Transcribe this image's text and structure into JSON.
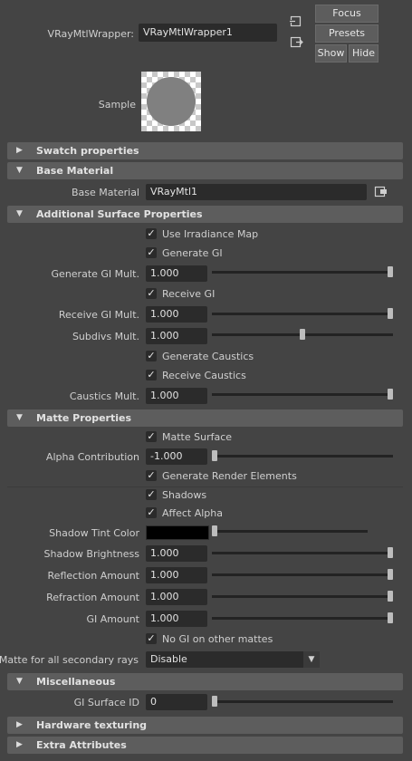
{
  "header": {
    "node_label": "VRayMtlWrapper:",
    "node_value": "VRayMtlWrapper1",
    "focus_label": "Focus",
    "presets_label": "Presets",
    "show_label": "Show",
    "hide_label": "Hide",
    "sample_label": "Sample"
  },
  "sections": {
    "swatch": "Swatch properties",
    "base": "Base Material",
    "additional": "Additional Surface Properties",
    "matte": "Matte Properties",
    "misc": "Miscellaneous",
    "hardware": "Hardware texturing",
    "extra": "Extra Attributes"
  },
  "base": {
    "label": "Base Material",
    "value": "VRayMtl1"
  },
  "additional": {
    "use_irradiance": "Use Irradiance Map",
    "generate_gi": "Generate GI",
    "generate_gi_mult_label": "Generate GI Mult.",
    "generate_gi_mult_value": "1.000",
    "receive_gi": "Receive GI",
    "receive_gi_mult_label": "Receive GI Mult.",
    "receive_gi_mult_value": "1.000",
    "subdivs_mult_label": "Subdivs Mult.",
    "subdivs_mult_value": "1.000",
    "generate_caustics": "Generate Caustics",
    "receive_caustics": "Receive Caustics",
    "caustics_mult_label": "Caustics Mult.",
    "caustics_mult_value": "1.000"
  },
  "matte": {
    "matte_surface": "Matte Surface",
    "alpha_contribution_label": "Alpha Contribution",
    "alpha_contribution_value": "-1.000",
    "generate_render_elements": "Generate Render Elements",
    "shadows": "Shadows",
    "affect_alpha": "Affect Alpha",
    "shadow_tint_label": "Shadow Tint Color",
    "shadow_tint_color": "#000000",
    "shadow_brightness_label": "Shadow Brightness",
    "shadow_brightness_value": "1.000",
    "reflection_amount_label": "Reflection Amount",
    "reflection_amount_value": "1.000",
    "refraction_amount_label": "Refraction Amount",
    "refraction_amount_value": "1.000",
    "gi_amount_label": "GI Amount",
    "gi_amount_value": "1.000",
    "no_gi_other_mattes": "No GI on other mattes",
    "matte_secondary_label": "Matte for all secondary rays",
    "matte_secondary_value": "Disable"
  },
  "misc": {
    "gi_surface_id_label": "GI Surface ID",
    "gi_surface_id_value": "0"
  },
  "colors": {
    "background": "#444444",
    "section_header": "#5d5d5d",
    "field": "#2b2b2b"
  }
}
